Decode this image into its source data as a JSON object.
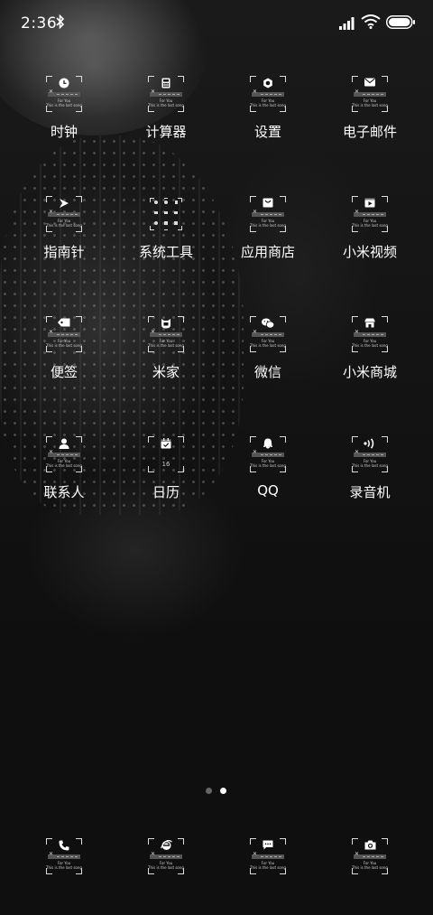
{
  "status_bar": {
    "time": "2:36",
    "bluetooth_icon": "bluetooth-icon",
    "signal_icon": "signal-icon",
    "wifi_icon": "wifi-icon",
    "battery_icon": "battery-icon"
  },
  "icon_caption": {
    "line1": "For You",
    "line2": "This is the last song"
  },
  "apps": [
    {
      "label": "时钟",
      "icon": "clock-icon"
    },
    {
      "label": "计算器",
      "icon": "calculator-icon"
    },
    {
      "label": "设置",
      "icon": "gear-icon"
    },
    {
      "label": "电子邮件",
      "icon": "mail-icon"
    },
    {
      "label": "指南针",
      "icon": "compass-icon"
    },
    {
      "label": "系统工具",
      "icon": "tools-folder-icon"
    },
    {
      "label": "应用商店",
      "icon": "store-bag-icon"
    },
    {
      "label": "小米视频",
      "icon": "video-icon"
    },
    {
      "label": "便签",
      "icon": "tag-icon"
    },
    {
      "label": "米家",
      "icon": "mijia-icon"
    },
    {
      "label": "微信",
      "icon": "wechat-icon"
    },
    {
      "label": "小米商城",
      "icon": "shop-icon"
    },
    {
      "label": "联系人",
      "icon": "contact-icon"
    },
    {
      "label": "日历",
      "icon": "calendar-icon"
    },
    {
      "label": "QQ",
      "icon": "qq-icon"
    },
    {
      "label": "录音机",
      "icon": "recorder-icon"
    }
  ],
  "calendar_day": "16",
  "page_indicator": {
    "pages": 2,
    "current": 2
  },
  "dock": [
    {
      "icon": "phone-icon"
    },
    {
      "icon": "browser-icon"
    },
    {
      "icon": "message-icon"
    },
    {
      "icon": "camera-icon"
    }
  ]
}
